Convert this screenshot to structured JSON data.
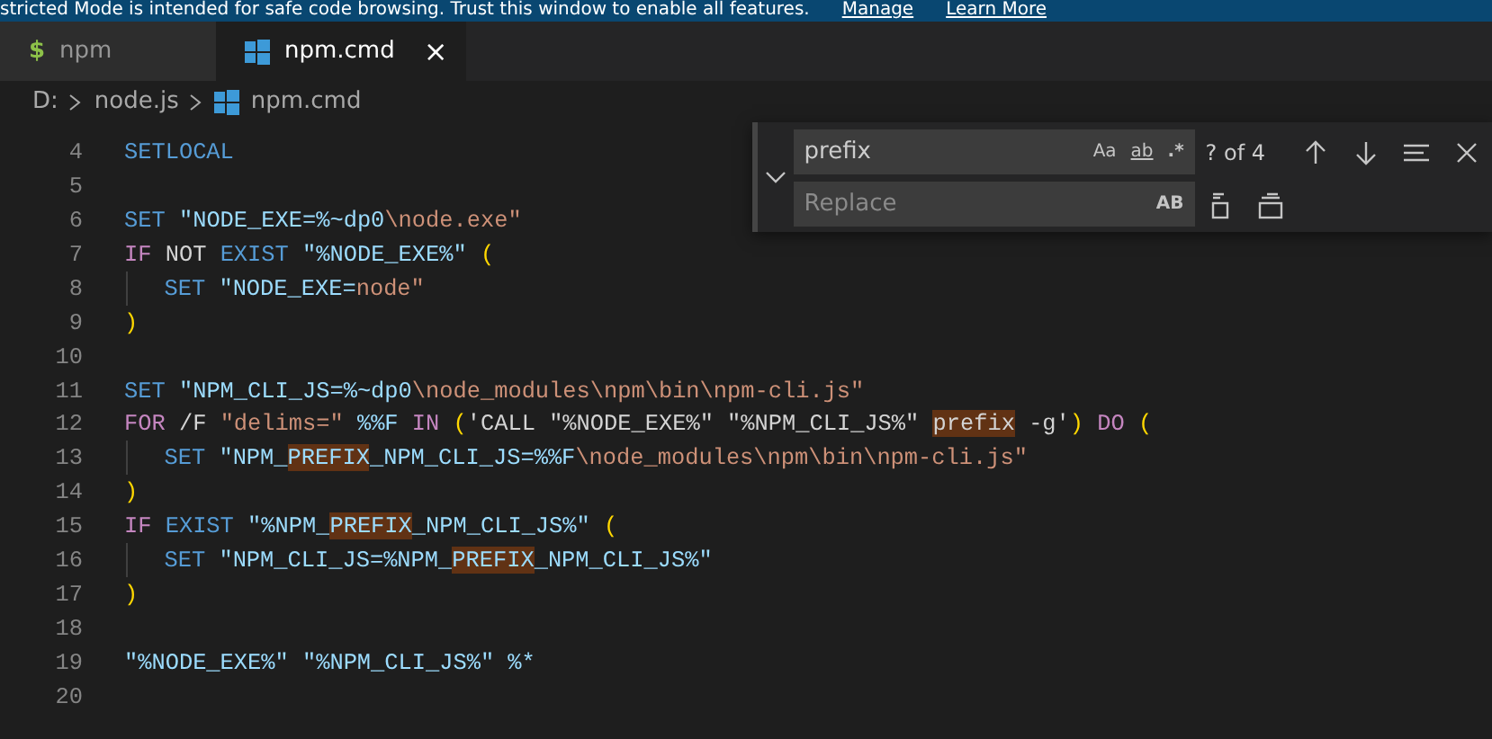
{
  "banner": {
    "message": "stricted Mode is intended for safe code browsing. Trust this window to enable all features.",
    "links": [
      "Manage",
      "Learn More"
    ]
  },
  "tabs": [
    {
      "label": "npm",
      "icon": "$",
      "selected": false,
      "kind": "shell"
    },
    {
      "label": "npm.cmd",
      "selected": true,
      "kind": "windows",
      "close": "×"
    }
  ],
  "breadcrumb": [
    {
      "label": "D:",
      "kind": "text"
    },
    {
      "label": "node.js",
      "kind": "text"
    },
    {
      "label": "npm.cmd",
      "kind": "windows"
    }
  ],
  "find_widget": {
    "find": {
      "value": "prefix",
      "options": [
        "Aa",
        "ab",
        ".*"
      ]
    },
    "result": "? of 4",
    "replace": {
      "placeholder": "Replace",
      "option": "AB"
    }
  },
  "lines": [
    {
      "number": "4",
      "indented": false,
      "tokens": [
        {
          "text": "SETLOCAL",
          "kind": "kw"
        }
      ]
    },
    {
      "number": "5",
      "indented": false
    },
    {
      "number": "6",
      "indented": false,
      "tokens": [
        {
          "text": "SET ",
          "kind": "kw"
        },
        {
          "text": "\"NODE_EXE=%~dp0",
          "kind": "var"
        },
        {
          "text": "\\node.exe\"",
          "kind": "str"
        }
      ]
    },
    {
      "number": "7",
      "indented": false,
      "tokens": [
        {
          "text": "IF ",
          "kind": "ctl"
        },
        {
          "text": "NOT ",
          "kind": "plain"
        },
        {
          "text": "EXIST ",
          "kind": "kw"
        },
        {
          "text": "\"%NODE_EXE%\" ",
          "kind": "var"
        },
        {
          "text": "(",
          "kind": "paren"
        }
      ]
    },
    {
      "number": "8",
      "indented": true,
      "tokens": [
        {
          "text": "SET ",
          "kind": "kw"
        },
        {
          "text": "\"NODE_EXE=",
          "kind": "var"
        },
        {
          "text": "node\"",
          "kind": "str"
        }
      ]
    },
    {
      "number": "9",
      "indented": false,
      "tokens": [
        {
          "text": ")",
          "kind": "paren"
        }
      ]
    },
    {
      "number": "10",
      "indented": false
    },
    {
      "number": "11",
      "indented": false,
      "tokens": [
        {
          "text": "SET ",
          "kind": "kw"
        },
        {
          "text": "\"NPM_CLI_JS=%~dp0",
          "kind": "var"
        },
        {
          "text": "\\node_modules\\npm\\bin\\npm-cli.js\"",
          "kind": "str"
        }
      ]
    },
    {
      "number": "12",
      "indented": false,
      "tokens": [
        {
          "text": "FOR ",
          "kind": "ctl"
        },
        {
          "text": "/F ",
          "kind": "plain"
        },
        {
          "text": "\"delims=\" ",
          "kind": "str"
        },
        {
          "text": "%%F ",
          "kind": "var"
        },
        {
          "text": "IN ",
          "kind": "ctl"
        },
        {
          "text": "(",
          "kind": "paren"
        },
        {
          "text": "'CALL \"%NODE_EXE%\" \"%NPM_CLI_JS%\" ",
          "kind": "plain"
        },
        {
          "text": "prefix",
          "kind": "plain",
          "match": true
        },
        {
          "text": " -g'",
          "kind": "plain"
        },
        {
          "text": ") ",
          "kind": "paren"
        },
        {
          "text": "DO ",
          "kind": "ctl"
        },
        {
          "text": "(",
          "kind": "paren"
        }
      ]
    },
    {
      "number": "13",
      "indented": true,
      "tokens": [
        {
          "text": "SET ",
          "kind": "kw"
        },
        {
          "text": "\"NPM_",
          "kind": "var"
        },
        {
          "text": "PREFIX",
          "kind": "var",
          "match": true
        },
        {
          "text": "_NPM_CLI_JS=%%F",
          "kind": "var"
        },
        {
          "text": "\\node_modules\\npm\\bin\\npm-cli.js\"",
          "kind": "str"
        }
      ]
    },
    {
      "number": "14",
      "indented": false,
      "tokens": [
        {
          "text": ")",
          "kind": "paren"
        }
      ]
    },
    {
      "number": "15",
      "indented": false,
      "tokens": [
        {
          "text": "IF ",
          "kind": "ctl"
        },
        {
          "text": "EXIST ",
          "kind": "kw"
        },
        {
          "text": "\"%NPM_",
          "kind": "var"
        },
        {
          "text": "PREFIX",
          "kind": "var",
          "match": true
        },
        {
          "text": "_NPM_CLI_JS%\" ",
          "kind": "var"
        },
        {
          "text": "(",
          "kind": "paren"
        }
      ]
    },
    {
      "number": "16",
      "indented": true,
      "tokens": [
        {
          "text": "SET ",
          "kind": "kw"
        },
        {
          "text": "\"NPM_CLI_JS=%NPM_",
          "kind": "var"
        },
        {
          "text": "PREFIX",
          "kind": "var",
          "match": true
        },
        {
          "text": "_NPM_CLI_JS%\"",
          "kind": "var"
        }
      ]
    },
    {
      "number": "17",
      "indented": false,
      "tokens": [
        {
          "text": ")",
          "kind": "paren"
        }
      ]
    },
    {
      "number": "18",
      "indented": false
    },
    {
      "number": "19",
      "indented": false,
      "tokens": [
        {
          "text": "\"%NODE_EXE%\" \"%NPM_CLI_JS%\" %*",
          "kind": "var"
        }
      ]
    },
    {
      "number": "20",
      "indented": false
    }
  ]
}
